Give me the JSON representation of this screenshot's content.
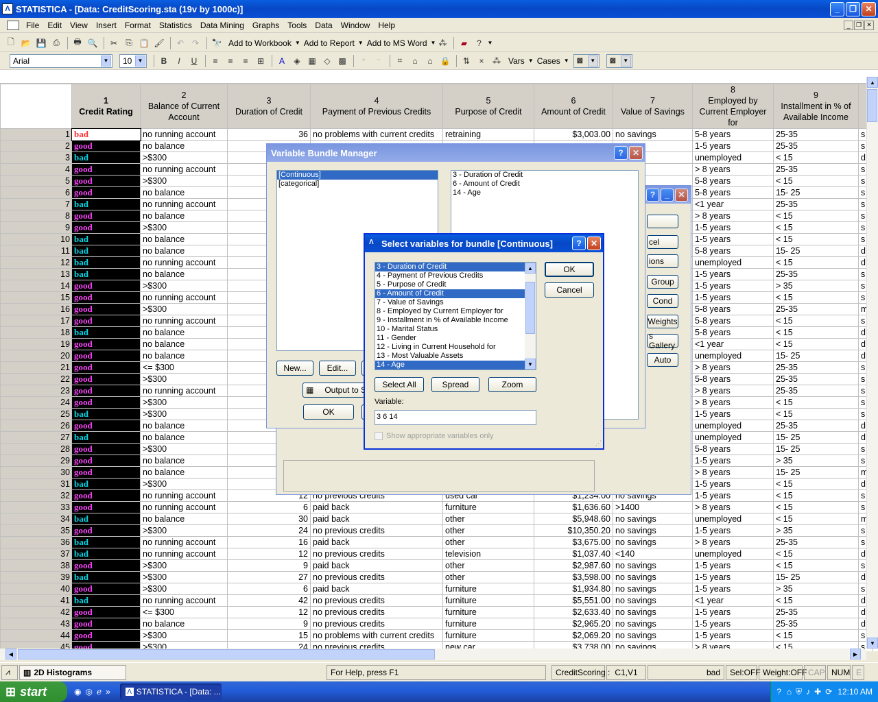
{
  "app": {
    "title": "STATISTICA - [Data: CreditScoring.sta (19v by 1000c)]",
    "icon": "statistica-icon"
  },
  "menu": [
    "File",
    "Edit",
    "View",
    "Insert",
    "Format",
    "Statistics",
    "Data Mining",
    "Graphs",
    "Tools",
    "Data",
    "Window",
    "Help"
  ],
  "toolbar": {
    "add_workbook": "Add to Workbook",
    "add_report": "Add to Report",
    "add_word": "Add to MS Word",
    "font": "Arial",
    "size": "10",
    "vars": "Vars",
    "cases": "Cases"
  },
  "columns": [
    {
      "num": "1",
      "name": "Credit Rating"
    },
    {
      "num": "2",
      "name": "Balance of Current Account"
    },
    {
      "num": "3",
      "name": "Duration of Credit"
    },
    {
      "num": "4",
      "name": "Payment of Previous Credits"
    },
    {
      "num": "5",
      "name": "Purpose of Credit"
    },
    {
      "num": "6",
      "name": "Amount of Credit"
    },
    {
      "num": "7",
      "name": "Value of Savings"
    },
    {
      "num": "8",
      "name": "Employed by Current Employer for"
    },
    {
      "num": "9",
      "name": "Installment in % of Available Income"
    }
  ],
  "rows": [
    [
      "1",
      "bad",
      "no running account",
      "36",
      "no problems with current credits",
      "retraining",
      "$3,003.00",
      "no savings",
      "5-8 years",
      "25-35",
      "s"
    ],
    [
      "2",
      "good",
      "no balance",
      "",
      "",
      "",
      "",
      "",
      "1-5 years",
      "25-35",
      "s"
    ],
    [
      "3",
      "bad",
      ">$300",
      "",
      "",
      "",
      "",
      "",
      "unemployed",
      "< 15",
      "d"
    ],
    [
      "4",
      "good",
      "no running account",
      "",
      "",
      "",
      "",
      "",
      "> 8 years",
      "25-35",
      "s"
    ],
    [
      "5",
      "good",
      ">$300",
      "",
      "",
      "",
      "",
      "",
      "5-8 years",
      "< 15",
      "s"
    ],
    [
      "6",
      "good",
      "no balance",
      "",
      "",
      "",
      "",
      "",
      "5-8 years",
      "15- 25",
      "s"
    ],
    [
      "7",
      "bad",
      "no running account",
      "",
      "",
      "",
      "",
      "",
      "<1 year",
      "25-35",
      "s"
    ],
    [
      "8",
      "good",
      "no balance",
      "",
      "",
      "",
      "",
      "",
      "> 8 years",
      "< 15",
      "s"
    ],
    [
      "9",
      "good",
      ">$300",
      "",
      "",
      "",
      "",
      "",
      "1-5 years",
      "< 15",
      "s"
    ],
    [
      "10",
      "bad",
      "no balance",
      "",
      "",
      "",
      "",
      "",
      "1-5 years",
      "< 15",
      "s"
    ],
    [
      "11",
      "bad",
      "no balance",
      "",
      "",
      "",
      "",
      "",
      "5-8 years",
      "15- 25",
      "d"
    ],
    [
      "12",
      "bad",
      "no running account",
      "",
      "",
      "",
      "",
      "",
      "unemployed",
      "< 15",
      "d"
    ],
    [
      "13",
      "bad",
      "no balance",
      "",
      "",
      "",
      "",
      "",
      "1-5 years",
      "25-35",
      "s"
    ],
    [
      "14",
      "good",
      ">$300",
      "",
      "",
      "",
      "",
      "",
      "1-5 years",
      "> 35",
      "s"
    ],
    [
      "15",
      "good",
      "no running account",
      "",
      "",
      "",
      "",
      "",
      "1-5 years",
      "< 15",
      "s"
    ],
    [
      "16",
      "good",
      ">$300",
      "",
      "",
      "",
      "",
      "",
      "5-8 years",
      "25-35",
      "m"
    ],
    [
      "17",
      "good",
      "no running account",
      "",
      "",
      "",
      "",
      "",
      "5-8 years",
      "< 15",
      "s"
    ],
    [
      "18",
      "bad",
      "no balance",
      "",
      "",
      "",
      "",
      "",
      "5-8 years",
      "< 15",
      "d"
    ],
    [
      "19",
      "good",
      "no balance",
      "",
      "",
      "",
      "",
      "",
      "<1 year",
      "< 15",
      "d"
    ],
    [
      "20",
      "good",
      "no balance",
      "",
      "",
      "",
      "",
      "",
      "unemployed",
      "15- 25",
      "d"
    ],
    [
      "21",
      "good",
      "<= $300",
      "",
      "",
      "",
      "",
      "",
      "> 8 years",
      "25-35",
      "s"
    ],
    [
      "22",
      "good",
      ">$300",
      "",
      "",
      "",
      "",
      "",
      "5-8 years",
      "25-35",
      "s"
    ],
    [
      "23",
      "good",
      "no running account",
      "",
      "",
      "",
      "",
      "",
      "> 8 years",
      "25-35",
      "s"
    ],
    [
      "24",
      "good",
      ">$300",
      "",
      "",
      "",
      "",
      "",
      "> 8 years",
      "< 15",
      "s"
    ],
    [
      "25",
      "bad",
      ">$300",
      "",
      "",
      "",
      "",
      "",
      "1-5 years",
      "< 15",
      "s"
    ],
    [
      "26",
      "good",
      "no balance",
      "",
      "",
      "",
      "",
      "",
      "unemployed",
      "25-35",
      "d"
    ],
    [
      "27",
      "bad",
      "no balance",
      "",
      "",
      "",
      "",
      "",
      "unemployed",
      "15- 25",
      "d"
    ],
    [
      "28",
      "good",
      ">$300",
      "",
      "",
      "",
      "",
      "",
      "5-8 years",
      "15- 25",
      "s"
    ],
    [
      "29",
      "good",
      "no balance",
      "",
      "",
      "",
      "",
      "",
      "1-5 years",
      "> 35",
      "s"
    ],
    [
      "30",
      "good",
      "no balance",
      "",
      "",
      "",
      "",
      "",
      "> 8 years",
      "15- 25",
      "m"
    ],
    [
      "31",
      "bad",
      ">$300",
      "",
      "",
      "",
      "",
      "",
      "1-5 years",
      "< 15",
      "d"
    ],
    [
      "32",
      "good",
      "no running account",
      "12",
      "no previous credits",
      "used car",
      "$1,234.00",
      "no savings",
      "1-5 years",
      "< 15",
      "s"
    ],
    [
      "33",
      "good",
      "no running account",
      "6",
      "paid back",
      "furniture",
      "$1,636.60",
      ">1400",
      "> 8 years",
      "< 15",
      "s"
    ],
    [
      "34",
      "bad",
      "no balance",
      "30",
      "paid back",
      "other",
      "$5,948.60",
      "no savings",
      "unemployed",
      "< 15",
      "m"
    ],
    [
      "35",
      "good",
      ">$300",
      "24",
      "no previous credits",
      "other",
      "$10,350.20",
      "no savings",
      "1-5 years",
      "> 35",
      "s"
    ],
    [
      "36",
      "bad",
      "no running account",
      "16",
      "paid back",
      "other",
      "$3,675.00",
      "no savings",
      "> 8 years",
      "25-35",
      "s"
    ],
    [
      "37",
      "bad",
      "no running account",
      "12",
      "no previous credits",
      "television",
      "$1,037.40",
      "<140",
      "unemployed",
      "< 15",
      "d"
    ],
    [
      "38",
      "good",
      ">$300",
      "9",
      "paid back",
      "other",
      "$2,987.60",
      "no savings",
      "1-5 years",
      "< 15",
      "s"
    ],
    [
      "39",
      "bad",
      ">$300",
      "27",
      "no previous credits",
      "other",
      "$3,598.00",
      "no savings",
      "1-5 years",
      "15- 25",
      "d"
    ],
    [
      "40",
      "good",
      ">$300",
      "6",
      "paid back",
      "furniture",
      "$1,934.80",
      "no savings",
      "1-5 years",
      "> 35",
      "s"
    ],
    [
      "41",
      "bad",
      "no running account",
      "42",
      "no previous credits",
      "furniture",
      "$5,551.00",
      "no savings",
      "<1 year",
      "< 15",
      "d"
    ],
    [
      "42",
      "good",
      "<= $300",
      "12",
      "no previous credits",
      "furniture",
      "$2,633.40",
      "no savings",
      "1-5 years",
      "25-35",
      "d"
    ],
    [
      "43",
      "good",
      "no balance",
      "9",
      "no previous credits",
      "furniture",
      "$2,965.20",
      "no savings",
      "1-5 years",
      "25-35",
      "d"
    ],
    [
      "44",
      "good",
      ">$300",
      "15",
      "no problems with current credits",
      "furniture",
      "$2,069.20",
      "no savings",
      "1-5 years",
      "< 15",
      "s"
    ],
    [
      "45",
      "good",
      ">$300",
      "24",
      "no previous credits",
      "new car",
      "$3,738.00",
      "no savings",
      "> 8 years",
      "< 15",
      "s"
    ]
  ],
  "colors": {
    "bad": "#ff3030",
    "good_magenta": "#ff40ff",
    "bad_cyan": "#00d8e8"
  },
  "vbm": {
    "title": "Variable Bundle Manager",
    "bundles": [
      "[Continuous]",
      "[categorical]"
    ],
    "members": [
      "3 - Duration of Credit",
      "6 - Amount of Credit",
      "14 - Age"
    ],
    "new": "New...",
    "edit": "Edit...",
    "output": "Output to S",
    "ok": "OK"
  },
  "back_dialog": {
    "buttons": [
      "",
      "cel",
      "ions",
      "Group",
      "Cond",
      "Weights",
      "s Gallery",
      "Auto"
    ]
  },
  "select": {
    "title": "Select variables for bundle [Continuous]",
    "items": [
      {
        "label": "3 - Duration of Credit",
        "selected": true
      },
      {
        "label": "4 - Payment of Previous Credits",
        "selected": false
      },
      {
        "label": "5 - Purpose of Credit",
        "selected": false
      },
      {
        "label": "6 - Amount of Credit",
        "selected": true
      },
      {
        "label": "7 - Value of Savings",
        "selected": false
      },
      {
        "label": "8 - Employed by Current Employer for",
        "selected": false
      },
      {
        "label": "9 - Installment in % of Available Income",
        "selected": false
      },
      {
        "label": "10 - Marital Status",
        "selected": false
      },
      {
        "label": "11 - Gender",
        "selected": false
      },
      {
        "label": "12 - Living in Current Household for",
        "selected": false
      },
      {
        "label": "13 - Most Valuable Assets",
        "selected": false
      },
      {
        "label": "14 - Age",
        "selected": true
      }
    ],
    "ok": "OK",
    "cancel": "Cancel",
    "select_all": "Select All",
    "spread": "Spread",
    "zoom": "Zoom",
    "variable_label": "Variable:",
    "variable_value": "3 6 14",
    "show_appropriate": "Show appropriate variables only"
  },
  "status": {
    "doc": "2D Histograms",
    "help": "For Help, press F1",
    "file": "CreditScoring.:",
    "cell": "C1,V1",
    "value": "bad",
    "sel": "Sel:OFF",
    "weight": "Weight:OFF",
    "cap": "CAP",
    "num": "NUM",
    "e": "E"
  },
  "taskbar": {
    "start": "start",
    "task": "STATISTICA - [Data: ...",
    "time": "12:10 AM"
  }
}
